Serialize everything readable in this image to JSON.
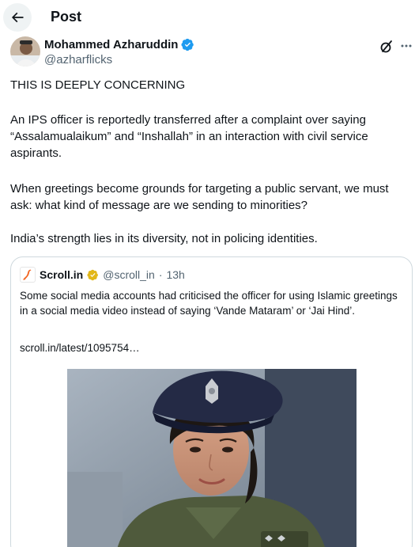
{
  "header": {
    "title": "Post"
  },
  "author": {
    "name": "Mohammed Azharuddin",
    "handle": "@azharflicks"
  },
  "post": {
    "paragraphs": [
      "THIS IS DEEPLY CONCERNING",
      "An IPS officer is reportedly transferred after a complaint over saying “Assalamualaikum” and “Inshallah” in an interaction with civil service aspirants.",
      "When greetings become grounds for targeting a public servant, we must ask: what kind of message are we sending to minorities?",
      "India’s strength lies in its diversity, not in policing identities."
    ]
  },
  "quote": {
    "source_name": "Scroll.in",
    "source_handle": "@scroll_in",
    "separator": "·",
    "age": "13h",
    "text": "Some social media accounts had criticised the officer for using Islamic greetings in a social media video instead of saying ‘Vande Mataram’ or ‘Jai Hind’.",
    "link": "scroll.in/latest/1095754…"
  },
  "icons": {
    "back": "arrow-left-icon",
    "verified": "verified-badge-icon",
    "grok": "grok-icon",
    "more": "more-icon"
  },
  "colors": {
    "verified_blue": "#1d9bf0",
    "verified_gold": "#e2b719",
    "text_secondary": "#536471",
    "border": "#cfd9de",
    "scroll_logo": "#f26522"
  }
}
